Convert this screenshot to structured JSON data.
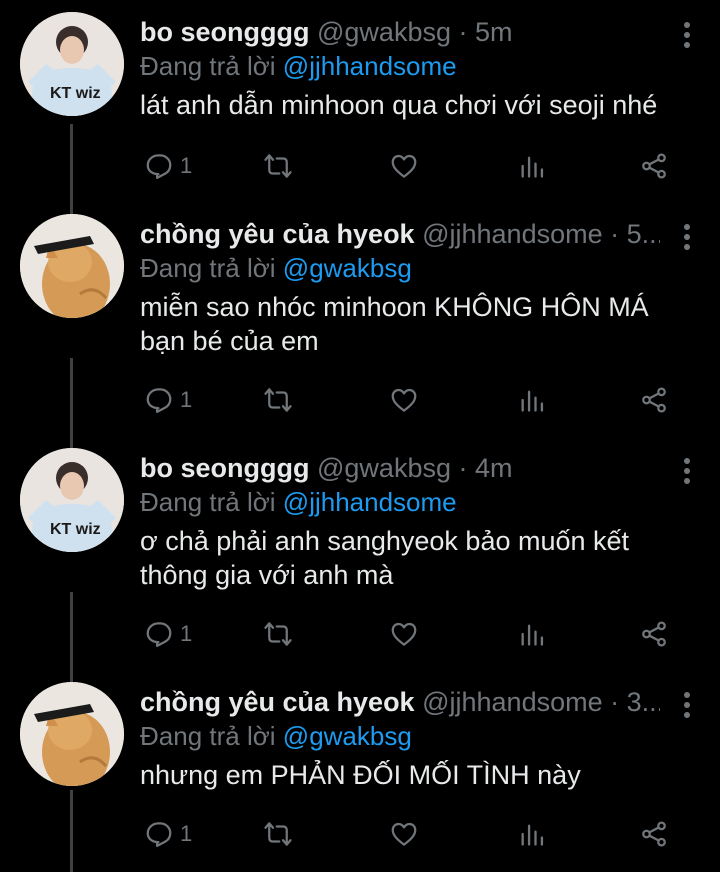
{
  "labels": {
    "replying_to": "Đang trả lời"
  },
  "tweets": [
    {
      "name": "bo seongggg",
      "handle": "@gwakbsg",
      "time": "5m",
      "reply_to": "@jjhhandsome",
      "text": "lát anh dẫn minhoon qua chơi với seoji nhé",
      "reply_count": "1",
      "avatar": "player-photo"
    },
    {
      "name": "chồng yêu của hyeok",
      "handle": "@jjhhandsome",
      "time": "5...",
      "reply_to": "@gwakbsg",
      "text": "miễn sao nhóc minhoon KHÔNG HÔN MÁ bạn bé của em",
      "reply_count": "1",
      "avatar": "cat-photo"
    },
    {
      "name": "bo seongggg",
      "handle": "@gwakbsg",
      "time": "4m",
      "reply_to": "@jjhhandsome",
      "text": "ơ chả phải anh sanghyeok bảo muốn kết thông gia với anh mà",
      "reply_count": "1",
      "avatar": "player-photo"
    },
    {
      "name": "chồng yêu của hyeok",
      "handle": "@jjhhandsome",
      "time": "3...",
      "reply_to": "@gwakbsg",
      "text": "nhưng em PHẢN ĐỐI MỐI TÌNH này",
      "reply_count": "1",
      "avatar": "cat-photo"
    }
  ],
  "colors": {
    "background": "#000000",
    "mention": "#1d9bf0",
    "muted": "#71767b",
    "text": "#e7e9ea"
  }
}
